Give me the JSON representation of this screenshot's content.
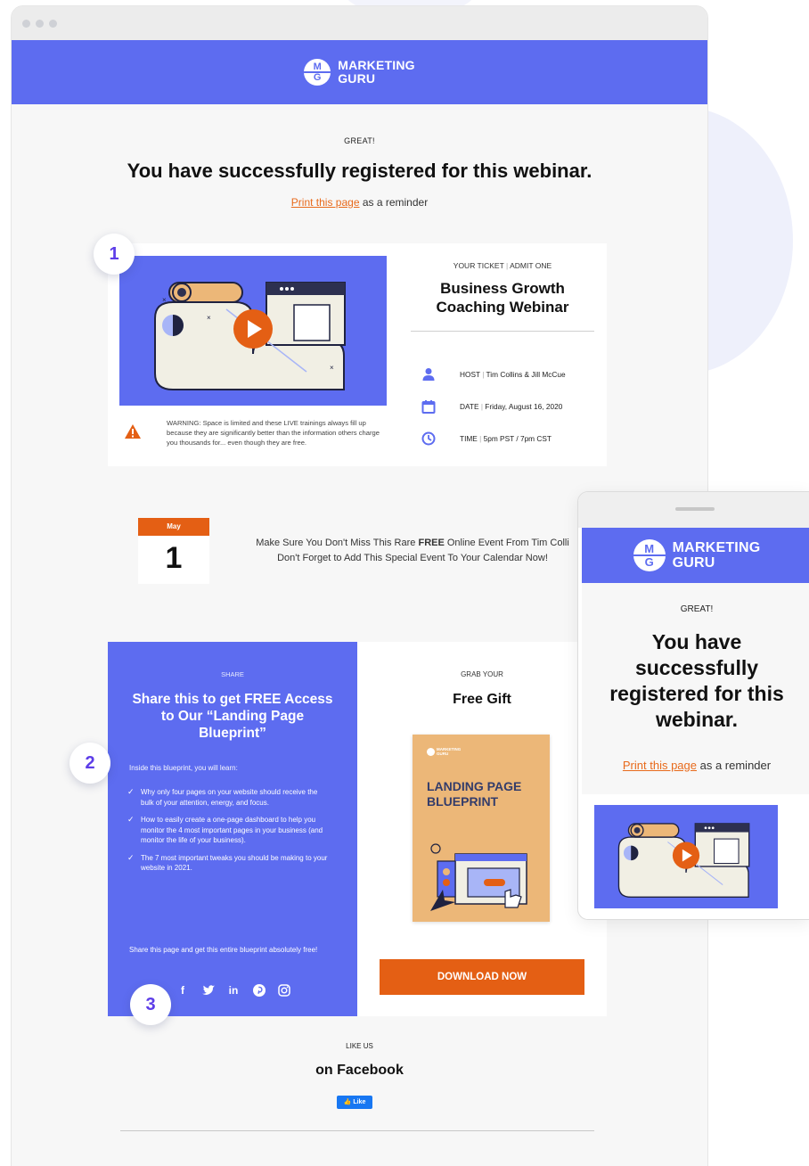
{
  "brand": {
    "logo_letters": {
      "top": "M",
      "bottom": "G"
    },
    "line1": "MARKETING",
    "line2": "GURU",
    "color": "#5d6cf0"
  },
  "hero": {
    "eyebrow": "GREAT!",
    "title": "You have successfully registered for this webinar.",
    "print_link": "Print this page",
    "print_suffix": " as a reminder"
  },
  "ticket": {
    "eyebrow": "YOUR TICKET",
    "eyebrow_sep": "|",
    "eyebrow_sub": "ADMIT ONE",
    "title": "Business Growth Coaching Webinar",
    "rows": [
      {
        "icon": "person-icon",
        "label": "HOST",
        "value": "Tim Collins & Jill McCue"
      },
      {
        "icon": "calendar-icon",
        "label": "DATE",
        "value": "Friday, August 16, 2020"
      },
      {
        "icon": "clock-icon",
        "label": "TIME",
        "value": "5pm PST / 7pm CST"
      }
    ],
    "warning": "WARNING: Space is limited and these LIVE trainings always fill up because they are significantly better than the information others charge you thousands for... even though they are free."
  },
  "calendar": {
    "month": "May",
    "day": "1",
    "line1_pre": "Make Sure You Don't Miss This Rare ",
    "line1_bold": "FREE",
    "line1_post": " Online Event From Tim Colli",
    "line2": "Don't Forget to Add This Special Event To Your Calendar Now!"
  },
  "share": {
    "eyebrow": "SHARE",
    "title": "Share this to get FREE Access to Our “Landing Page Blueprint”",
    "intro": "Inside this blueprint, you will learn:",
    "items": [
      "Why only four pages on your website should receive the bulk of your attention, energy, and focus.",
      "How to easily create a one-page dashboard to help you monitor the 4 most important pages in your business (and monitor the life of your business).",
      "The 7 most important tweaks you should be making to your website in 2021."
    ],
    "outro": "Share this page and get this entire blueprint absolutely free!",
    "socials": [
      "facebook-icon",
      "twitter-icon",
      "linkedin-icon",
      "pinterest-icon",
      "instagram-icon"
    ]
  },
  "gift": {
    "eyebrow": "GRAB YOUR",
    "title": "Free Gift",
    "book_title": "LANDING PAGE BLUEPRINT",
    "book_logo_line1": "MARKETING",
    "book_logo_line2": "GURU",
    "button": "DOWNLOAD NOW",
    "button_color": "#e45f14"
  },
  "like": {
    "eyebrow": "LIKE US",
    "title": "on Facebook",
    "button": "Like"
  },
  "badges": [
    "1",
    "2",
    "3"
  ],
  "mobile": {
    "eyebrow": "GREAT!",
    "title": "You have successfully registered for this webinar.",
    "print_link": "Print this page",
    "print_suffix": " as a reminder"
  },
  "colors": {
    "accent": "#5d6cf0",
    "orange": "#e45f14",
    "badge_text": "#5d3de8"
  }
}
